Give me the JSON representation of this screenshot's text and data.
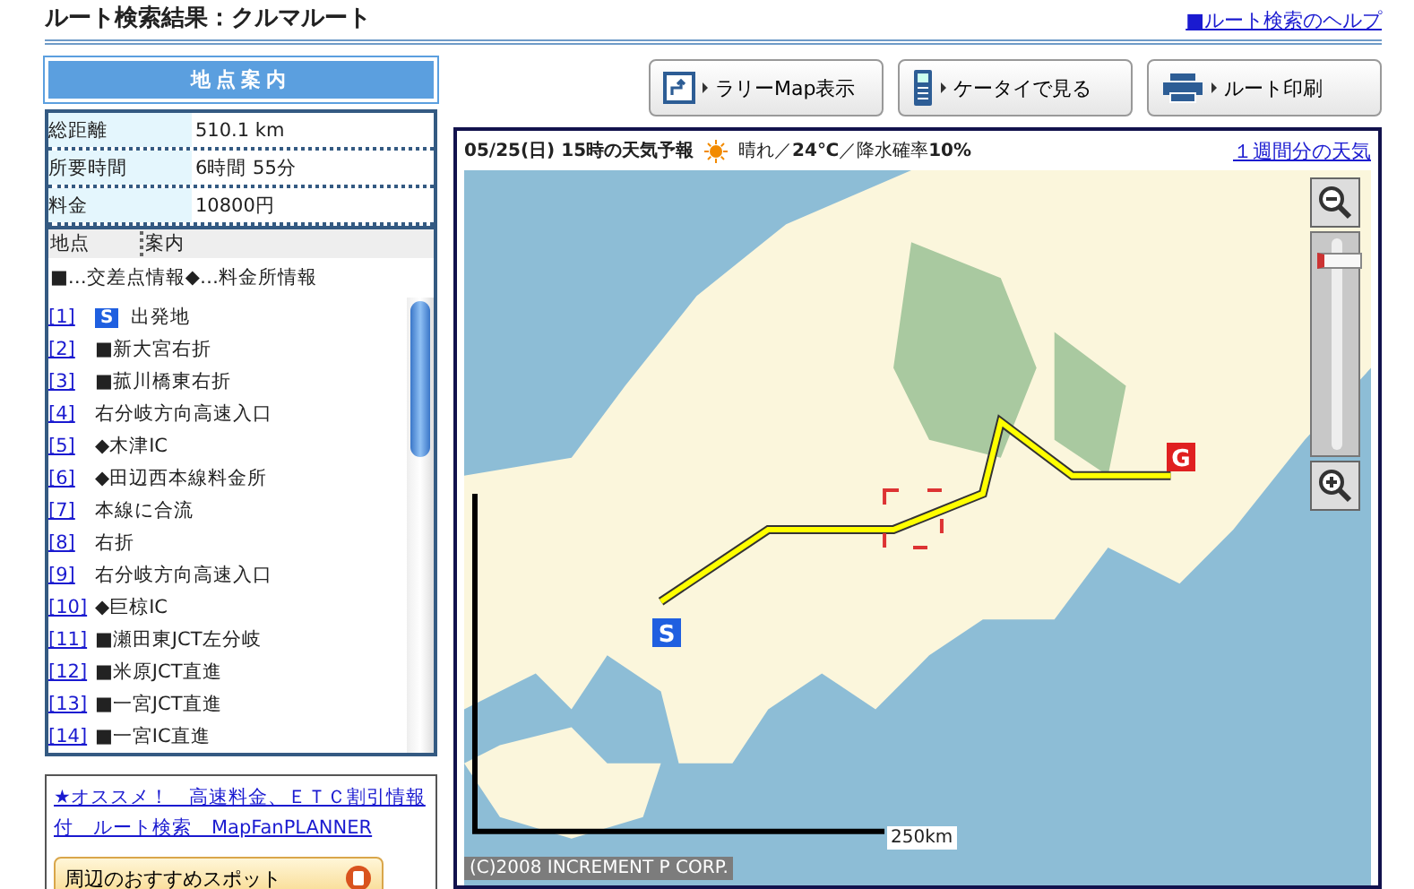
{
  "title": "ルート検索結果：クルマルート",
  "help_link": "■ルート検索のヘルプ",
  "side": {
    "heading": "地点案内",
    "summary": [
      {
        "label": "総距離",
        "value": "510.1 km"
      },
      {
        "label": "所要時間",
        "value": "6時間 55分"
      },
      {
        "label": "料金",
        "value": "10800円"
      }
    ],
    "list_header": [
      "地点",
      "案内"
    ],
    "legend": "■…交差点情報◆…料金所情報",
    "points": [
      {
        "num": "[1]",
        "badge": "S",
        "text": "出発地"
      },
      {
        "num": "[2]",
        "text": "■新大宮右折"
      },
      {
        "num": "[3]",
        "text": "■菰川橋東右折"
      },
      {
        "num": "[4]",
        "text": "右分岐方向高速入口"
      },
      {
        "num": "[5]",
        "text": "◆木津IC"
      },
      {
        "num": "[6]",
        "text": "◆田辺西本線料金所"
      },
      {
        "num": "[7]",
        "text": "本線に合流"
      },
      {
        "num": "[8]",
        "text": "右折"
      },
      {
        "num": "[9]",
        "text": "右分岐方向高速入口"
      },
      {
        "num": "[10]",
        "text": "◆巨椋IC"
      },
      {
        "num": "[11]",
        "text": "■瀬田東JCT左分岐"
      },
      {
        "num": "[12]",
        "text": "■米原JCT直進"
      },
      {
        "num": "[13]",
        "text": "■一宮JCT直進"
      },
      {
        "num": "[14]",
        "text": "■一宮IC直進"
      }
    ],
    "promo_link": "★オススメ！　高速料金、ＥＴＣ割引情報付　ルート検索　MapFanPLANNER",
    "spot_button": "周辺のおすすめスポット"
  },
  "toolbar": [
    {
      "label": "ラリーMap表示",
      "kind": "rally"
    },
    {
      "label": "ケータイで見る",
      "kind": "mobile"
    },
    {
      "label": "ルート印刷",
      "kind": "print"
    }
  ],
  "weather": {
    "date": "05/25(日) 15時の天気予報",
    "forecast": "晴れ／**24℃**／降水確率**10%**",
    "week_link": "１週間分の天気"
  },
  "map": {
    "start": "S",
    "goal": "G",
    "scale": "250km",
    "copyright": "(C)2008 INCREMENT P CORP.",
    "zoom": {
      "level": 0.92
    }
  }
}
